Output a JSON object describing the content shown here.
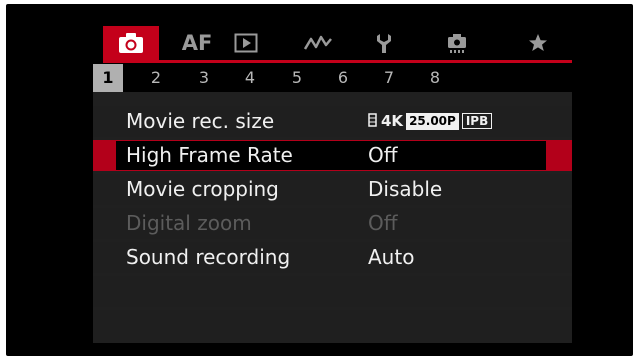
{
  "tabs": [
    {
      "name": "camera-tab",
      "icon": "camera-icon",
      "active": true
    },
    {
      "name": "af-tab",
      "label": "AF"
    },
    {
      "name": "playback-tab",
      "icon": "playback-icon"
    },
    {
      "name": "wireless-tab",
      "icon": "wireless-icon"
    },
    {
      "name": "setup-tab",
      "icon": "wrench-icon"
    },
    {
      "name": "custom-functions-tab",
      "icon": "custom-camera-icon"
    },
    {
      "name": "my-menu-tab",
      "icon": "star-icon"
    }
  ],
  "pages": [
    "1",
    "2",
    "3",
    "4",
    "5",
    "6",
    "7",
    "8"
  ],
  "menu": [
    {
      "label": "Movie rec. size",
      "value_parts": {
        "resolution": "4K",
        "framerate": "25.00P",
        "compression": "IPB"
      }
    },
    {
      "label": "High Frame Rate",
      "value": "Off",
      "selected": true
    },
    {
      "label": "Movie cropping",
      "value": "Disable"
    },
    {
      "label": "Digital zoom",
      "value": "Off",
      "disabled": true
    },
    {
      "label": "Sound recording",
      "value": "Auto"
    }
  ],
  "colors": {
    "accent": "#c4001a",
    "background": "#000000",
    "text": "#f0f0f0",
    "disabled": "#5c5c5c"
  }
}
